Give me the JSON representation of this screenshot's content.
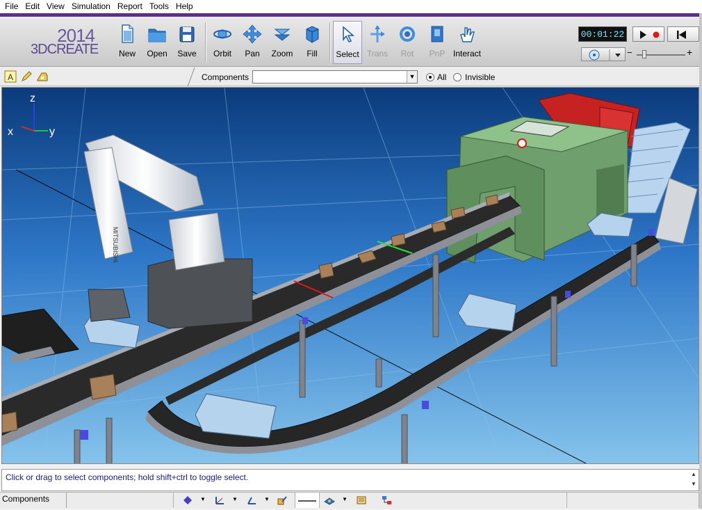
{
  "menu": [
    "File",
    "Edit",
    "View",
    "Simulation",
    "Report",
    "Tools",
    "Help"
  ],
  "logo": {
    "year": "2014",
    "name": "3DCREATE"
  },
  "toolbar": {
    "buttons": [
      {
        "label": "New",
        "icon": "new-document-icon"
      },
      {
        "label": "Open",
        "icon": "folder-open-icon"
      },
      {
        "label": "Save",
        "icon": "floppy-disk-icon"
      },
      {
        "label": "Orbit",
        "icon": "orbit-icon"
      },
      {
        "label": "Pan",
        "icon": "pan-arrows-icon"
      },
      {
        "label": "Zoom",
        "icon": "zoom-icon"
      },
      {
        "label": "Fill",
        "icon": "fill-cube-icon"
      },
      {
        "label": "Select",
        "icon": "select-arrow-icon"
      },
      {
        "label": "Trans",
        "icon": "translate-icon"
      },
      {
        "label": "Rot",
        "icon": "rotate-icon"
      },
      {
        "label": "PnP",
        "icon": "plug-and-play-icon"
      },
      {
        "label": "Interact",
        "icon": "interact-hand-icon"
      }
    ]
  },
  "simulation": {
    "time": "00:01:22"
  },
  "subbar": {
    "components_label": "Components",
    "components_value": "",
    "radio_all": "All",
    "radio_invisible": "Invisible",
    "selected_radio": "All"
  },
  "viewport": {
    "axes": {
      "z": "z",
      "x": "x",
      "y": "y"
    },
    "robot_brand": "MITSUBISHI",
    "background_top": "#0a3a7a",
    "background_bottom": "#7fbfea"
  },
  "status": {
    "message": "Click or drag to select components; hold shift+ctrl to toggle select."
  },
  "bottom": {
    "tab": "Components"
  },
  "colors": {
    "accent": "#5e2e8c",
    "time_text": "#6ee9ff"
  }
}
